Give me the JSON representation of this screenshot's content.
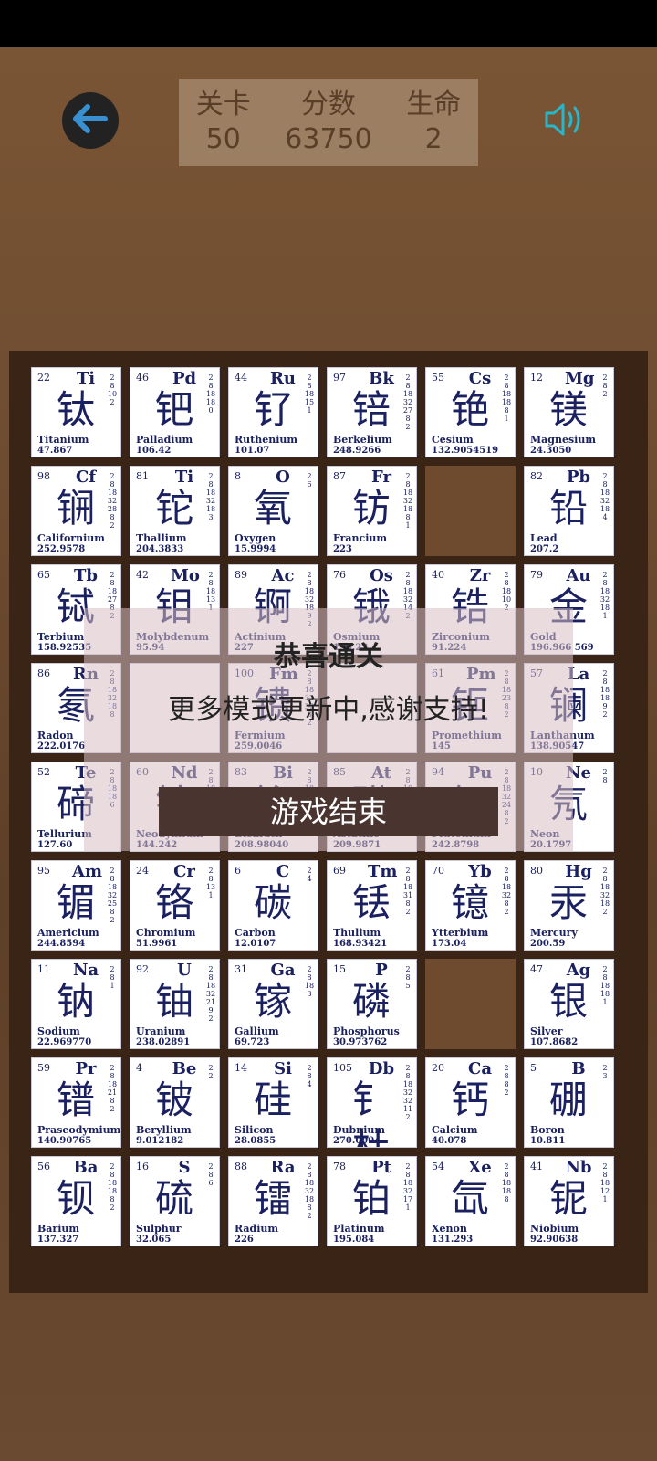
{
  "hud": {
    "level_label": "关卡",
    "level_value": "50",
    "score_label": "分数",
    "score_value": "63750",
    "lives_label": "生命",
    "lives_value": "2"
  },
  "overlay": {
    "title": "恭喜通关",
    "message": "更多模式更新中,感谢支持!",
    "button": "游戏结束"
  },
  "colors": {
    "accent": "#3a8fd0",
    "tile_text": "#1a2060"
  },
  "tiles": [
    {
      "num": "22",
      "sym": "Ti",
      "cn": "钛",
      "en": "Titanium",
      "mass": "47.867",
      "shells": [
        "2",
        "8",
        "10",
        "2"
      ]
    },
    {
      "num": "46",
      "sym": "Pd",
      "cn": "钯",
      "en": "Palladium",
      "mass": "106.42",
      "shells": [
        "2",
        "8",
        "18",
        "18",
        "0"
      ]
    },
    {
      "num": "44",
      "sym": "Ru",
      "cn": "钌",
      "en": "Ruthenium",
      "mass": "101.07",
      "shells": [
        "2",
        "8",
        "18",
        "15",
        "1"
      ]
    },
    {
      "num": "97",
      "sym": "Bk",
      "cn": "锫",
      "en": "Berkelium",
      "mass": "248.9266",
      "shells": [
        "2",
        "8",
        "18",
        "32",
        "27",
        "8",
        "2"
      ]
    },
    {
      "num": "55",
      "sym": "Cs",
      "cn": "铯",
      "en": "Cesium",
      "mass": "132.9054519",
      "shells": [
        "2",
        "8",
        "18",
        "18",
        "8",
        "1"
      ]
    },
    {
      "num": "12",
      "sym": "Mg",
      "cn": "镁",
      "en": "Magnesium",
      "mass": "24.3050",
      "shells": [
        "2",
        "8",
        "2"
      ]
    },
    {
      "num": "98",
      "sym": "Cf",
      "cn": "锎",
      "en": "Californium",
      "mass": "252.9578",
      "shells": [
        "2",
        "8",
        "18",
        "32",
        "28",
        "8",
        "2"
      ]
    },
    {
      "num": "81",
      "sym": "Ti",
      "cn": "铊",
      "en": "Thallium",
      "mass": "204.3833",
      "shells": [
        "2",
        "8",
        "18",
        "32",
        "18",
        "3"
      ]
    },
    {
      "num": "8",
      "sym": "O",
      "cn": "氧",
      "en": "Oxygen",
      "mass": "15.9994",
      "shells": [
        "2",
        "6"
      ]
    },
    {
      "num": "87",
      "sym": "Fr",
      "cn": "钫",
      "en": "Francium",
      "mass": "223",
      "shells": [
        "2",
        "8",
        "18",
        "32",
        "18",
        "8",
        "1"
      ]
    },
    null,
    {
      "num": "82",
      "sym": "Pb",
      "cn": "铅",
      "en": "Lead",
      "mass": "207.2",
      "shells": [
        "2",
        "8",
        "18",
        "32",
        "18",
        "4"
      ]
    },
    {
      "num": "65",
      "sym": "Tb",
      "cn": "铽",
      "en": "Terbium",
      "mass": "158.92535",
      "shells": [
        "2",
        "8",
        "18",
        "27",
        "8",
        "2"
      ]
    },
    {
      "num": "42",
      "sym": "Mo",
      "cn": "钼",
      "en": "Molybdenum",
      "mass": "95.94",
      "shells": [
        "2",
        "8",
        "18",
        "13",
        "1"
      ]
    },
    {
      "num": "89",
      "sym": "Ac",
      "cn": "锕",
      "en": "Actinium",
      "mass": "227",
      "shells": [
        "2",
        "8",
        "18",
        "32",
        "18",
        "9",
        "2"
      ]
    },
    {
      "num": "76",
      "sym": "Os",
      "cn": "锇",
      "en": "Osmium",
      "mass": "190.23",
      "shells": [
        "2",
        "8",
        "18",
        "32",
        "14",
        "2"
      ]
    },
    {
      "num": "40",
      "sym": "Zr",
      "cn": "锆",
      "en": "Zirconium",
      "mass": "91.224",
      "shells": [
        "2",
        "8",
        "18",
        "10",
        "2"
      ]
    },
    {
      "num": "79",
      "sym": "Au",
      "cn": "金",
      "en": "Gold",
      "mass": "196.966 569",
      "shells": [
        "2",
        "8",
        "18",
        "32",
        "18",
        "1"
      ]
    },
    {
      "num": "86",
      "sym": "Rn",
      "cn": "氡",
      "en": "Radon",
      "mass": "222.0176",
      "shells": [
        "2",
        "8",
        "18",
        "32",
        "18",
        "8"
      ]
    },
    {
      "num": "",
      "sym": "",
      "cn": "",
      "en": "",
      "mass": "",
      "shells": []
    },
    {
      "num": "100",
      "sym": "Fm",
      "cn": "镄",
      "en": "Fermium",
      "mass": "259.0046",
      "shells": [
        "2",
        "8",
        "18",
        "32",
        "30",
        "8",
        "2"
      ]
    },
    {
      "num": "",
      "sym": "",
      "cn": "",
      "en": "",
      "mass": "",
      "shells": []
    },
    {
      "num": "61",
      "sym": "Pm",
      "cn": "钷",
      "en": "Promethium",
      "mass": "145",
      "shells": [
        "2",
        "8",
        "18",
        "23",
        "8",
        "2"
      ]
    },
    {
      "num": "57",
      "sym": "La",
      "cn": "镧",
      "en": "Lanthanum",
      "mass": "138.90547",
      "shells": [
        "2",
        "8",
        "18",
        "18",
        "9",
        "2"
      ]
    },
    {
      "num": "52",
      "sym": "Te",
      "cn": "碲",
      "en": "Tellurium",
      "mass": "127.60",
      "shells": [
        "2",
        "8",
        "18",
        "18",
        "6"
      ]
    },
    {
      "num": "60",
      "sym": "Nd",
      "cn": "钕",
      "en": "Neodymium",
      "mass": "144.242",
      "shells": [
        "2",
        "8",
        "18",
        "22",
        "8",
        "2"
      ]
    },
    {
      "num": "83",
      "sym": "Bi",
      "cn": "铋",
      "en": "Bismuth",
      "mass": "208.98040",
      "shells": [
        "2",
        "8",
        "18",
        "32",
        "18",
        "5"
      ]
    },
    {
      "num": "85",
      "sym": "At",
      "cn": "砹",
      "en": "Astatine",
      "mass": "209.9871",
      "shells": [
        "2",
        "8",
        "18",
        "32",
        "18",
        "7"
      ]
    },
    {
      "num": "94",
      "sym": "Pu",
      "cn": "钚",
      "en": "Plutonium",
      "mass": "242.8798",
      "shells": [
        "2",
        "8",
        "18",
        "32",
        "24",
        "8",
        "2"
      ]
    },
    {
      "num": "10",
      "sym": "Ne",
      "cn": "氖",
      "en": "Neon",
      "mass": "20.1797",
      "shells": [
        "2",
        "8"
      ]
    },
    {
      "num": "95",
      "sym": "Am",
      "cn": "镅",
      "en": "Americium",
      "mass": "244.8594",
      "shells": [
        "2",
        "8",
        "18",
        "32",
        "25",
        "8",
        "2"
      ]
    },
    {
      "num": "24",
      "sym": "Cr",
      "cn": "铬",
      "en": "Chromium",
      "mass": "51.9961",
      "shells": [
        "2",
        "8",
        "13",
        "1"
      ]
    },
    {
      "num": "6",
      "sym": "C",
      "cn": "碳",
      "en": "Carbon",
      "mass": "12.0107",
      "shells": [
        "2",
        "4"
      ]
    },
    {
      "num": "69",
      "sym": "Tm",
      "cn": "铥",
      "en": "Thulium",
      "mass": "168.93421",
      "shells": [
        "2",
        "8",
        "18",
        "31",
        "8",
        "2"
      ]
    },
    {
      "num": "70",
      "sym": "Yb",
      "cn": "镱",
      "en": "Ytterbium",
      "mass": "173.04",
      "shells": [
        "2",
        "8",
        "18",
        "32",
        "8",
        "2"
      ]
    },
    {
      "num": "80",
      "sym": "Hg",
      "cn": "汞",
      "en": "Mercury",
      "mass": "200.59",
      "shells": [
        "2",
        "8",
        "18",
        "32",
        "18",
        "2"
      ]
    },
    {
      "num": "11",
      "sym": "Na",
      "cn": "钠",
      "en": "Sodium",
      "mass": "22.969770",
      "shells": [
        "2",
        "8",
        "1"
      ]
    },
    {
      "num": "92",
      "sym": "U",
      "cn": "铀",
      "en": "Uranium",
      "mass": "238.02891",
      "shells": [
        "2",
        "8",
        "18",
        "32",
        "21",
        "9",
        "2"
      ]
    },
    {
      "num": "31",
      "sym": "Ga",
      "cn": "镓",
      "en": "Gallium",
      "mass": "69.723",
      "shells": [
        "2",
        "8",
        "18",
        "3"
      ]
    },
    {
      "num": "15",
      "sym": "P",
      "cn": "磷",
      "en": "Phosphorus",
      "mass": "30.973762",
      "shells": [
        "2",
        "8",
        "5"
      ]
    },
    null,
    {
      "num": "47",
      "sym": "Ag",
      "cn": "银",
      "en": "Silver",
      "mass": "107.8682",
      "shells": [
        "2",
        "8",
        "18",
        "18",
        "1"
      ]
    },
    {
      "num": "59",
      "sym": "Pr",
      "cn": "镨",
      "en": "Praseodymium",
      "mass": "140.90765",
      "shells": [
        "2",
        "8",
        "18",
        "21",
        "8",
        "2"
      ]
    },
    {
      "num": "4",
      "sym": "Be",
      "cn": "铍",
      "en": "Beryllium",
      "mass": "9.012182",
      "shells": [
        "2",
        "2"
      ]
    },
    {
      "num": "14",
      "sym": "Si",
      "cn": "硅",
      "en": "Silicon",
      "mass": "28.0855",
      "shells": [
        "2",
        "8",
        "4"
      ]
    },
    {
      "num": "105",
      "sym": "Db",
      "cn": "钅杜",
      "en": "Dubnium",
      "mass": "270.0904",
      "shells": [
        "2",
        "8",
        "18",
        "32",
        "32",
        "11",
        "2"
      ]
    },
    {
      "num": "20",
      "sym": "Ca",
      "cn": "钙",
      "en": "Calcium",
      "mass": "40.078",
      "shells": [
        "2",
        "8",
        "8",
        "2"
      ]
    },
    {
      "num": "5",
      "sym": "B",
      "cn": "硼",
      "en": "Boron",
      "mass": "10.811",
      "shells": [
        "2",
        "3"
      ]
    },
    {
      "num": "56",
      "sym": "Ba",
      "cn": "钡",
      "en": "Barium",
      "mass": "137.327",
      "shells": [
        "2",
        "8",
        "18",
        "18",
        "8",
        "2"
      ]
    },
    {
      "num": "16",
      "sym": "S",
      "cn": "硫",
      "en": "Sulphur",
      "mass": "32.065",
      "shells": [
        "2",
        "8",
        "6"
      ]
    },
    {
      "num": "88",
      "sym": "Ra",
      "cn": "镭",
      "en": "Radium",
      "mass": "226",
      "shells": [
        "2",
        "8",
        "18",
        "32",
        "18",
        "8",
        "2"
      ]
    },
    {
      "num": "78",
      "sym": "Pt",
      "cn": "铂",
      "en": "Platinum",
      "mass": "195.084",
      "shells": [
        "2",
        "8",
        "18",
        "32",
        "17",
        "1"
      ]
    },
    {
      "num": "54",
      "sym": "Xe",
      "cn": "氙",
      "en": "Xenon",
      "mass": "131.293",
      "shells": [
        "2",
        "8",
        "18",
        "18",
        "8"
      ]
    },
    {
      "num": "41",
      "sym": "Nb",
      "cn": "铌",
      "en": "Niobium",
      "mass": "92.90638",
      "shells": [
        "2",
        "8",
        "18",
        "12",
        "1"
      ]
    }
  ]
}
